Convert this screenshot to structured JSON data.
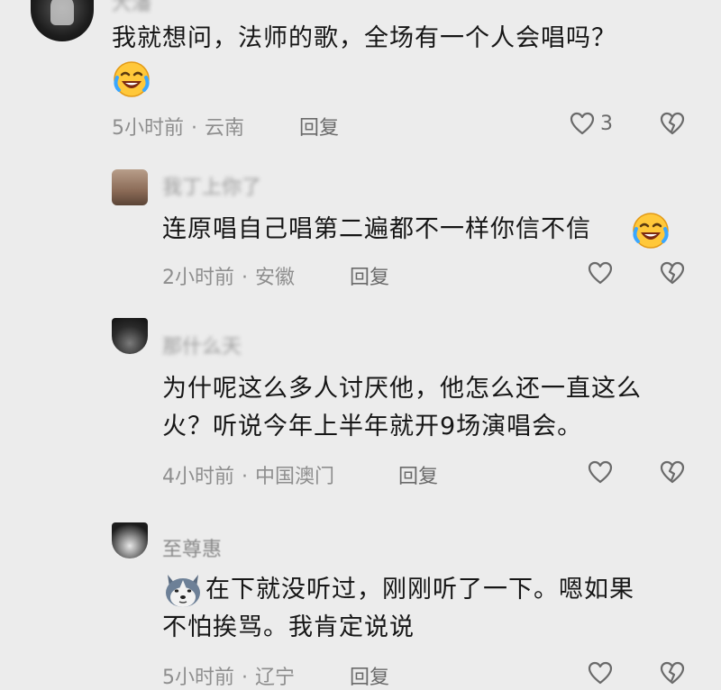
{
  "comments": [
    {
      "username": "大潘",
      "text": "我就想问，法师的歌，全场有一个人会唱吗？",
      "emoji": "laughing-crying-emoji",
      "time": "5小时前",
      "location": "云南",
      "reply_label": "回复",
      "like_count": "3"
    },
    {
      "username": "我丁上你了",
      "text": "连原唱自己唱第二遍都不一样你信不信",
      "emoji": "laughing-crying-emoji",
      "time": "2小时前",
      "location": "安徽",
      "reply_label": "回复"
    },
    {
      "username": "那什么天",
      "text_line1": "为什呢这么多人讨厌他，他怎么还一直这么",
      "text_line2": "火？听说今年上半年就开9场演唱会。",
      "time": "4小时前",
      "location": "中国澳门",
      "reply_label": "回复"
    },
    {
      "username": "至尊惠",
      "sticker": "husky-dog-sticker",
      "text_line1": "在下就没听过，刚刚听了一下。嗯如果",
      "text_line2": "不怕挨骂。我肯定说说",
      "time": "5小时前",
      "location": "辽宁",
      "reply_label": "回复"
    }
  ],
  "separator": "·",
  "colors": {
    "background": "#ececec",
    "text": "#161616",
    "meta": "#8e8e8e",
    "icon": "#6a6a6a"
  }
}
